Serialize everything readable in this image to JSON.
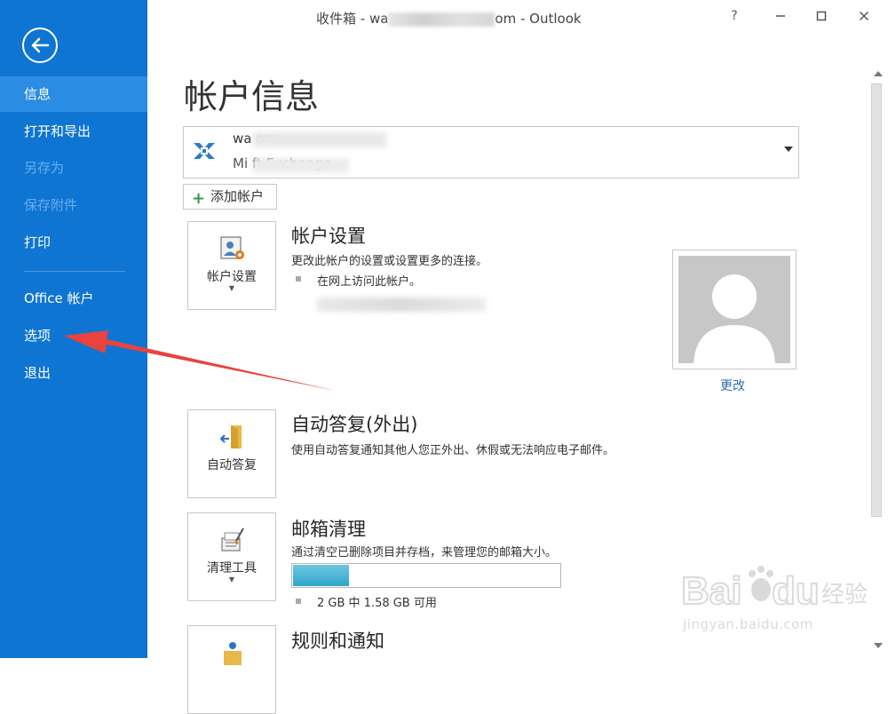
{
  "window": {
    "title_prefix": "收件箱 - wa",
    "title_suffix": "om - Outlook",
    "help": "?",
    "minimize": "–",
    "maximize": "□",
    "close": "✕"
  },
  "sidebar": {
    "back_icon": "back-arrow-icon",
    "items": [
      {
        "label": "信息",
        "state": "active"
      },
      {
        "label": "打开和导出",
        "state": "normal"
      },
      {
        "label": "另存为",
        "state": "disabled"
      },
      {
        "label": "保存附件",
        "state": "disabled"
      },
      {
        "label": "打印",
        "state": "normal"
      },
      {
        "label": "Office 帐户",
        "state": "normal"
      },
      {
        "label": "选项",
        "state": "normal"
      },
      {
        "label": "退出",
        "state": "normal"
      }
    ]
  },
  "main": {
    "page_title": "帐户信息",
    "account": {
      "email": "wa                    om",
      "type": "Mi                ft Exchange"
    },
    "add_account": "添加帐户",
    "account_settings": {
      "card_label": "帐户设置",
      "title": "帐户设置",
      "desc": "更改此帐户的设置或设置更多的连接。",
      "bullet": "在网上访问此帐户。",
      "avatar_change": "更改"
    },
    "auto_reply": {
      "card_label": "自动答复",
      "title": "自动答复(外出)",
      "desc": "使用自动答复通知其他人您正外出、休假或无法响应电子邮件。"
    },
    "cleanup": {
      "card_label": "清理工具",
      "title": "邮箱清理",
      "desc": "通过清空已删除项目并存档，来管理您的邮箱大小。",
      "storage_text": "2 GB 中 1.58 GB 可用",
      "used_fraction": 0.21
    },
    "rules": {
      "title": "规则和通知"
    }
  },
  "watermark": {
    "text": "jingyan.baidu.com"
  },
  "colors": {
    "sidebar": "#0f75d2",
    "sidebar_active": "#2a8ce2",
    "annotation_arrow": "#e8433e"
  }
}
